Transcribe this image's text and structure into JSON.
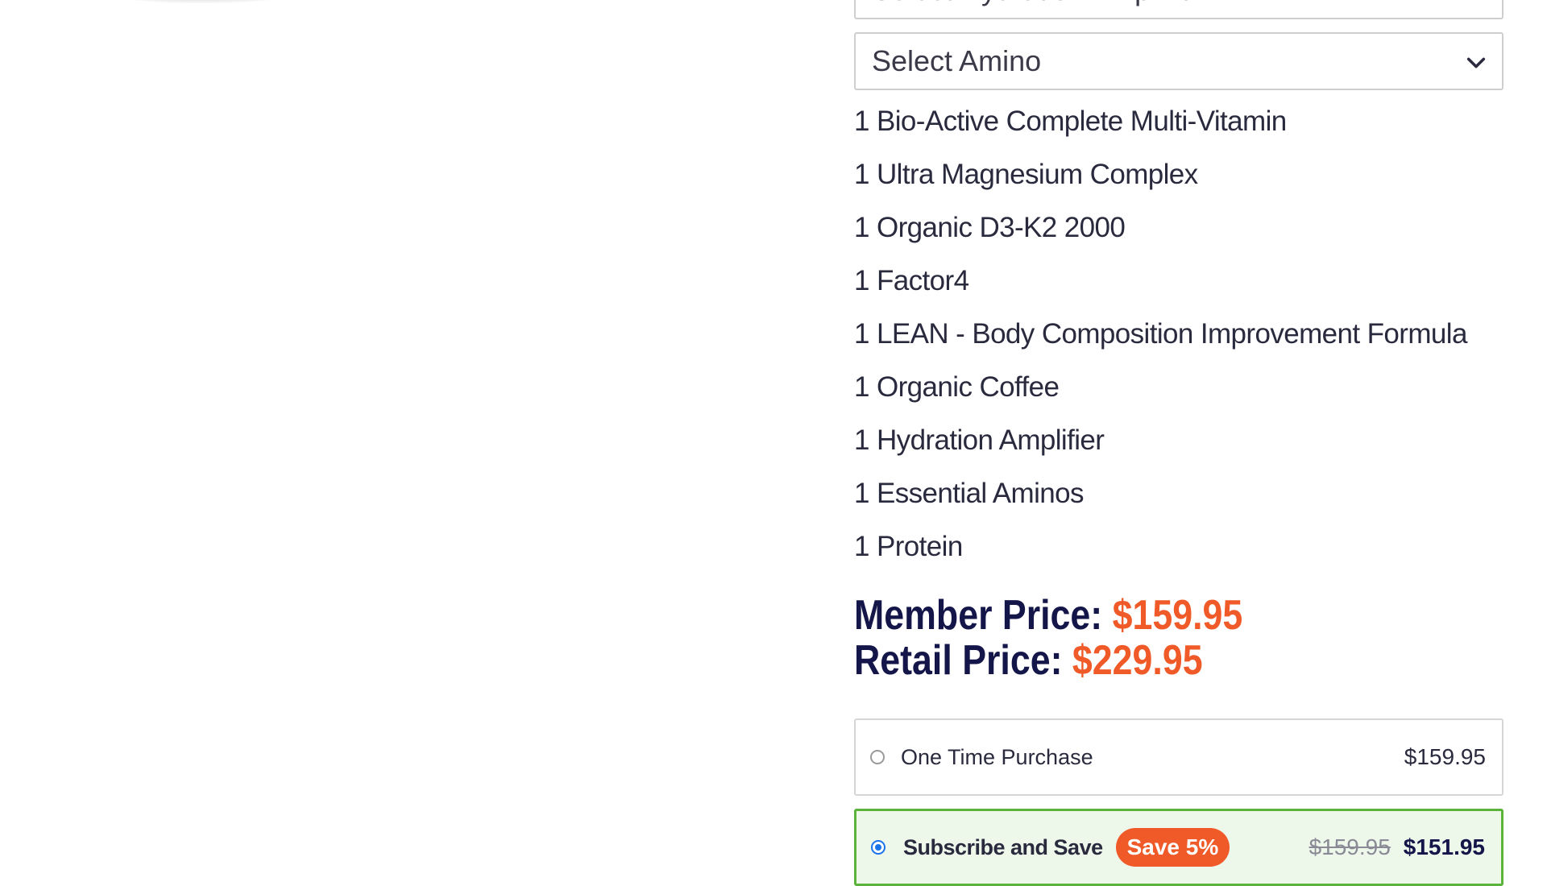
{
  "selects": {
    "hydration_placeholder": "Select Hydration Amplifier",
    "amino_placeholder": "Select Amino"
  },
  "bundle_items": [
    "1 Bio-Active Complete Multi-Vitamin",
    "1 Ultra Magnesium Complex",
    "1 Organic D3-K2 2000",
    "1 Factor4",
    "1 LEAN - Body Composition Improvement Formula",
    "1 Organic Coffee",
    "1 Hydration Amplifier",
    "1 Essential Aminos",
    "1 Protein"
  ],
  "pricing": {
    "member_label": "Member Price:",
    "member_value": "$159.95",
    "retail_label": "Retail Price:",
    "retail_value": "$229.95"
  },
  "purchase_options": {
    "one_time": {
      "label": "One Time Purchase",
      "price": "$159.95",
      "selected": false
    },
    "subscribe": {
      "label": "Subscribe and Save",
      "badge": "Save 5%",
      "old_price": "$159.95",
      "price": "$151.95",
      "selected": true
    }
  },
  "colors": {
    "accent_orange": "#f05a28",
    "navy": "#14164a",
    "selected_border_green": "#5bb33a"
  },
  "icons": {
    "select_arrow": "chevron-down-icon"
  }
}
